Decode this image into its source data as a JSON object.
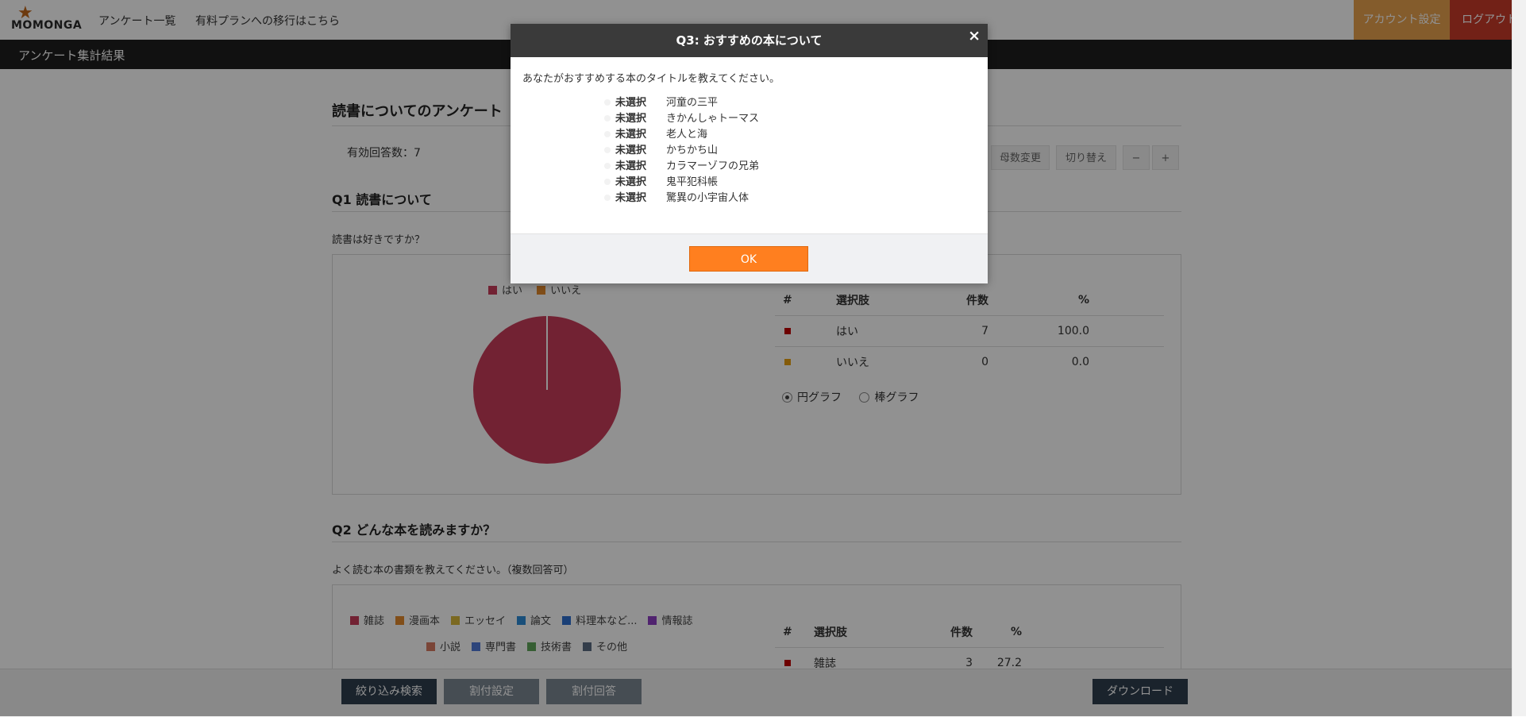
{
  "header": {
    "logo_text": "MOMONGA",
    "nav": [
      "アンケート一覧",
      "有料プランへの移行はこちら"
    ],
    "account_button": "アカウント設定",
    "logout_button": "ログアウト"
  },
  "subheader": {
    "title": "アンケート集計結果"
  },
  "survey": {
    "title": "読書についてのアンケート",
    "valid_count": "有効回答数：7",
    "tools": [
      "母数変更",
      "切り替え",
      "−",
      "+"
    ]
  },
  "q1": {
    "title": "Q1 読書について",
    "text": "読書は好きですか？",
    "legend": [
      {
        "label": "はい",
        "color": "#c93d5b"
      },
      {
        "label": "いいえ",
        "color": "#e38a2c"
      }
    ],
    "table": {
      "headers": [
        "#",
        "選択肢",
        "件数",
        "%"
      ],
      "rows": [
        {
          "color": "#c00000",
          "label": "はい",
          "count": "7",
          "pct": "100.0"
        },
        {
          "color": "#e8a010",
          "label": "いいえ",
          "count": "0",
          "pct": "0.0"
        }
      ]
    },
    "chart_toggle": [
      "円グラフ",
      "棒グラフ"
    ]
  },
  "q2": {
    "title": "Q2 どんな本を読みますか？",
    "text": "よく読む本の書類を教えてください。（複数回答可）",
    "legend_row1": [
      {
        "label": "雑誌",
        "color": "#c93d5b"
      },
      {
        "label": "漫画本",
        "color": "#e38a2c"
      },
      {
        "label": "エッセイ",
        "color": "#d9b93a"
      },
      {
        "label": "論文",
        "color": "#2d8bd6"
      },
      {
        "label": "料理本など...",
        "color": "#2f6fd0"
      },
      {
        "label": "情報誌",
        "color": "#8e3fc4"
      }
    ],
    "legend_row2": [
      {
        "label": "小説",
        "color": "#d77a62"
      },
      {
        "label": "専門書",
        "color": "#4f7ad8"
      },
      {
        "label": "技術書",
        "color": "#5fa65a"
      },
      {
        "label": "その他",
        "color": "#5a6b82"
      }
    ],
    "table": {
      "headers": [
        "#",
        "選択肢",
        "件数",
        "%"
      ],
      "rows": [
        {
          "color": "#c00000",
          "label": "雑誌",
          "count": "3",
          "pct": "27.2"
        }
      ]
    }
  },
  "chart_data": {
    "type": "pie",
    "categories": [
      "はい",
      "いいえ"
    ],
    "values": [
      7,
      0
    ],
    "legend": "top"
  },
  "footer": {
    "filter_button": "絞り込み検索",
    "crosstab_settings_button": "割付設定",
    "crosstab_answers_button": "割付回答",
    "download_button": "ダウンロード"
  },
  "modal": {
    "title": "Q3: おすすめの本について",
    "question": "あなたがおすすめする本のタイトルを教えてください。",
    "options": [
      {
        "status": "未選択",
        "label": "河童の三平"
      },
      {
        "status": "未選択",
        "label": "きかんしゃトーマス"
      },
      {
        "status": "未選択",
        "label": "老人と海"
      },
      {
        "status": "未選択",
        "label": "かちかち山"
      },
      {
        "status": "未選択",
        "label": "カラマーゾフの兄弟"
      },
      {
        "status": "未選択",
        "label": "鬼平犯科帳"
      },
      {
        "status": "未選択",
        "label": "驚異の小宇宙人体"
      }
    ],
    "ok_button": "OK",
    "close_icon": "×"
  }
}
